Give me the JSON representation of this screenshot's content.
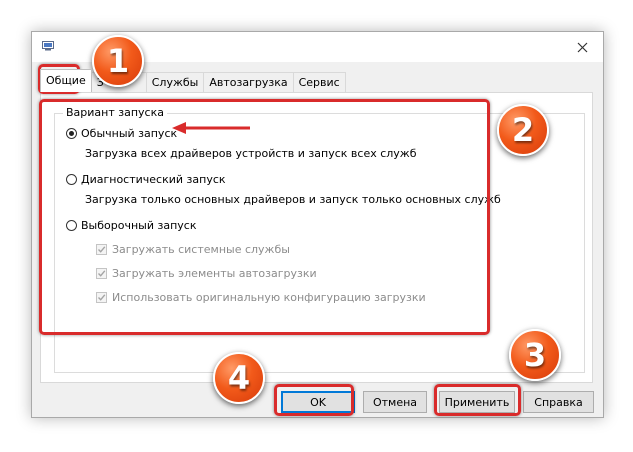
{
  "window": {
    "close_icon": "close-icon",
    "app_icon": "msconfig-icon"
  },
  "tabs": [
    {
      "label": "Общие",
      "active": true
    },
    {
      "label": "З",
      "active": false
    },
    {
      "label": "Службы",
      "active": false
    },
    {
      "label": "Автозагрузка",
      "active": false
    },
    {
      "label": "Сервис",
      "active": false
    }
  ],
  "startup": {
    "group_label": "Вариант запуска",
    "normal": {
      "label": "Обычный запуск",
      "desc": "Загрузка всех драйверов устройств и запуск всех служб",
      "checked": true
    },
    "diagnostic": {
      "label": "Диагностический запуск",
      "desc": "Загрузка только основных драйверов и запуск только основных служб",
      "checked": false
    },
    "selective": {
      "label": "Выборочный запуск",
      "checked": false
    },
    "options": [
      {
        "label": "Загружать системные службы",
        "checked": true
      },
      {
        "label": "Загружать элементы автозагрузки",
        "checked": true
      },
      {
        "label": "Использовать оригинальную конфигурацию загрузки",
        "checked": true
      }
    ]
  },
  "buttons": {
    "ok": "OK",
    "cancel": "Отмена",
    "apply": "Применить",
    "help": "Справка"
  },
  "annotations": {
    "badges": [
      "1",
      "2",
      "3",
      "4"
    ],
    "color": "#d92b2b"
  }
}
